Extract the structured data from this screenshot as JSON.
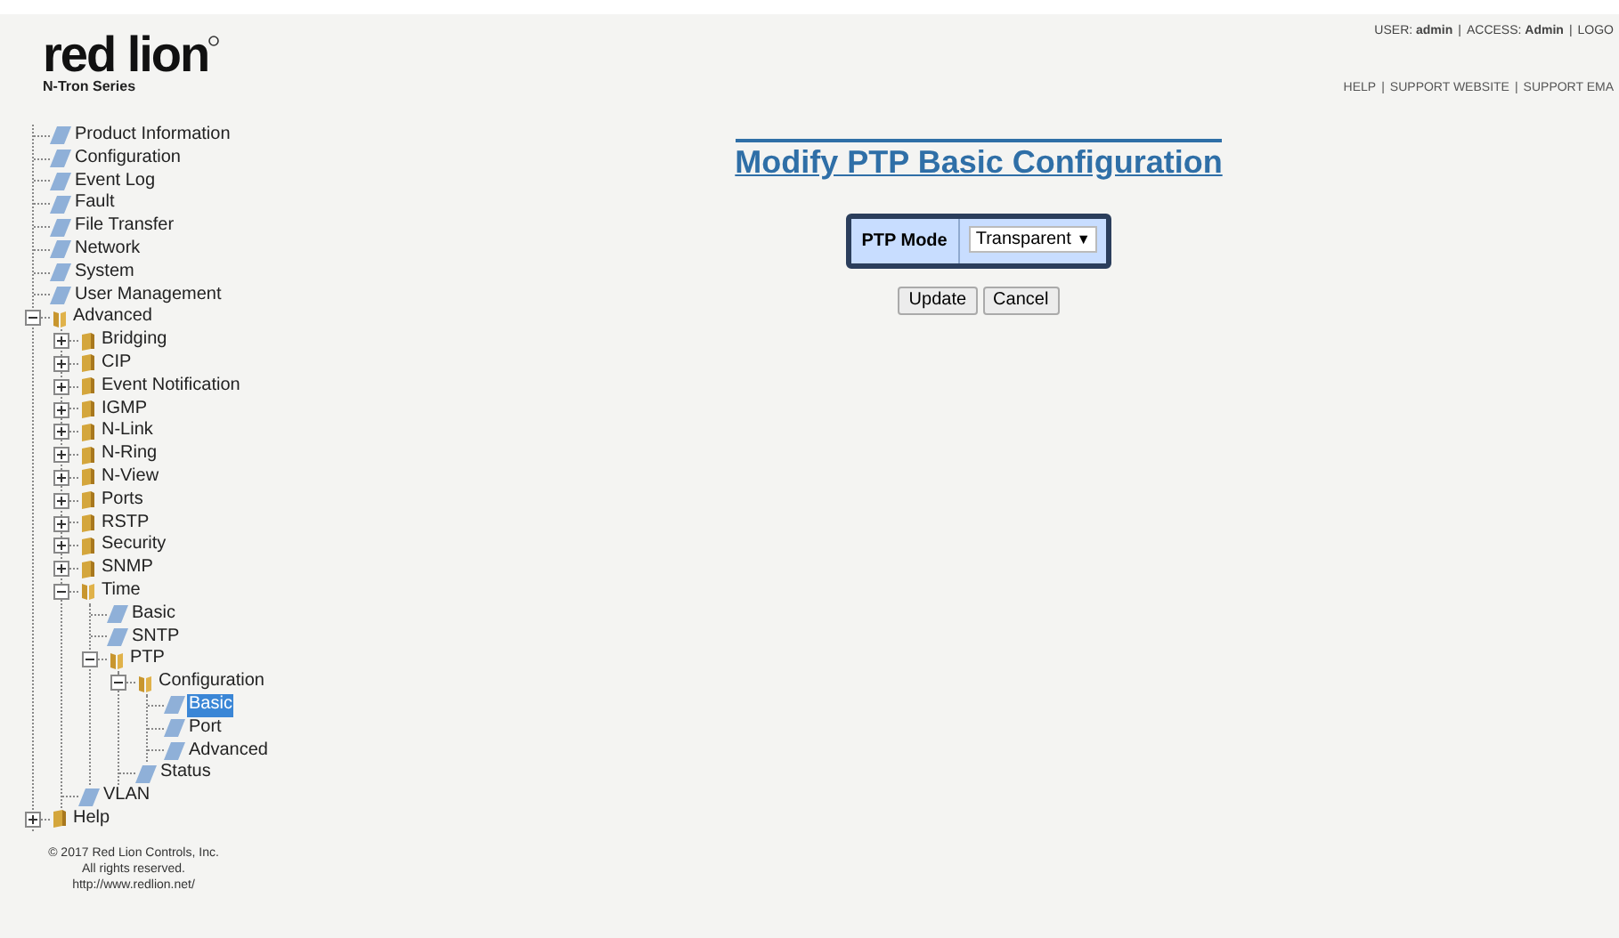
{
  "header": {
    "logo": {
      "wordmark": "red lion",
      "series": "N-Tron Series"
    },
    "user_bar": [
      "USER: **admin**",
      "|",
      "ACCESS: **Admin**",
      "|",
      "LOGO"
    ],
    "links": [
      "HELP",
      "|",
      "SUPPORT WEBSITE",
      "|",
      "SUPPORT EMA"
    ]
  },
  "tree": [
    {
      "label": "Product Information",
      "kind": "page",
      "selected": false
    },
    {
      "label": "Configuration",
      "kind": "page",
      "selected": false
    },
    {
      "label": "Event Log",
      "kind": "page",
      "selected": false
    },
    {
      "label": "Fault",
      "kind": "page",
      "selected": false
    },
    {
      "label": "File Transfer",
      "kind": "page",
      "selected": false
    },
    {
      "label": "Network",
      "kind": "page",
      "selected": false
    },
    {
      "label": "System",
      "kind": "page",
      "selected": false
    },
    {
      "label": "User Management",
      "kind": "page",
      "selected": false
    },
    {
      "label": "Advanced",
      "kind": "folder",
      "expanded": true,
      "selected": false,
      "children": [
        {
          "label": "Bridging",
          "kind": "folder",
          "expanded": false,
          "selected": false
        },
        {
          "label": "CIP",
          "kind": "folder",
          "expanded": false,
          "selected": false
        },
        {
          "label": "Event Notification",
          "kind": "folder",
          "expanded": false,
          "selected": false
        },
        {
          "label": "IGMP",
          "kind": "folder",
          "expanded": false,
          "selected": false
        },
        {
          "label": "N-Link",
          "kind": "folder",
          "expanded": false,
          "selected": false
        },
        {
          "label": "N-Ring",
          "kind": "folder",
          "expanded": false,
          "selected": false
        },
        {
          "label": "N-View",
          "kind": "folder",
          "expanded": false,
          "selected": false
        },
        {
          "label": "Ports",
          "kind": "folder",
          "expanded": false,
          "selected": false
        },
        {
          "label": "RSTP",
          "kind": "folder",
          "expanded": false,
          "selected": false
        },
        {
          "label": "Security",
          "kind": "folder",
          "expanded": false,
          "selected": false
        },
        {
          "label": "SNMP",
          "kind": "folder",
          "expanded": false,
          "selected": false
        },
        {
          "label": "Time",
          "kind": "folder",
          "expanded": true,
          "selected": false,
          "children": [
            {
              "label": "Basic",
              "kind": "page",
              "selected": false
            },
            {
              "label": "SNTP",
              "kind": "page",
              "selected": false
            },
            {
              "label": "PTP",
              "kind": "folder",
              "expanded": true,
              "selected": false,
              "children": [
                {
                  "label": "Configuration",
                  "kind": "folder",
                  "expanded": true,
                  "selected": false,
                  "children": [
                    {
                      "label": "Basic",
                      "kind": "page",
                      "selected": true
                    },
                    {
                      "label": "Port",
                      "kind": "page",
                      "selected": false
                    },
                    {
                      "label": "Advanced",
                      "kind": "page",
                      "selected": false
                    }
                  ]
                },
                {
                  "label": "Status",
                  "kind": "page",
                  "selected": false
                }
              ]
            }
          ]
        },
        {
          "label": "VLAN",
          "kind": "page",
          "selected": false
        }
      ]
    },
    {
      "label": "Help",
      "kind": "folder",
      "expanded": false,
      "selected": false
    }
  ],
  "copyright": [
    "© 2017 Red Lion Controls, Inc.",
    "All rights reserved.",
    "http://www.redlion.net/"
  ],
  "main": {
    "title": "Modify PTP Basic Configuration",
    "form": {
      "label": "PTP Mode",
      "value": "Transparent",
      "arrow": "▼"
    },
    "buttons": [
      "Update",
      "Cancel"
    ]
  }
}
